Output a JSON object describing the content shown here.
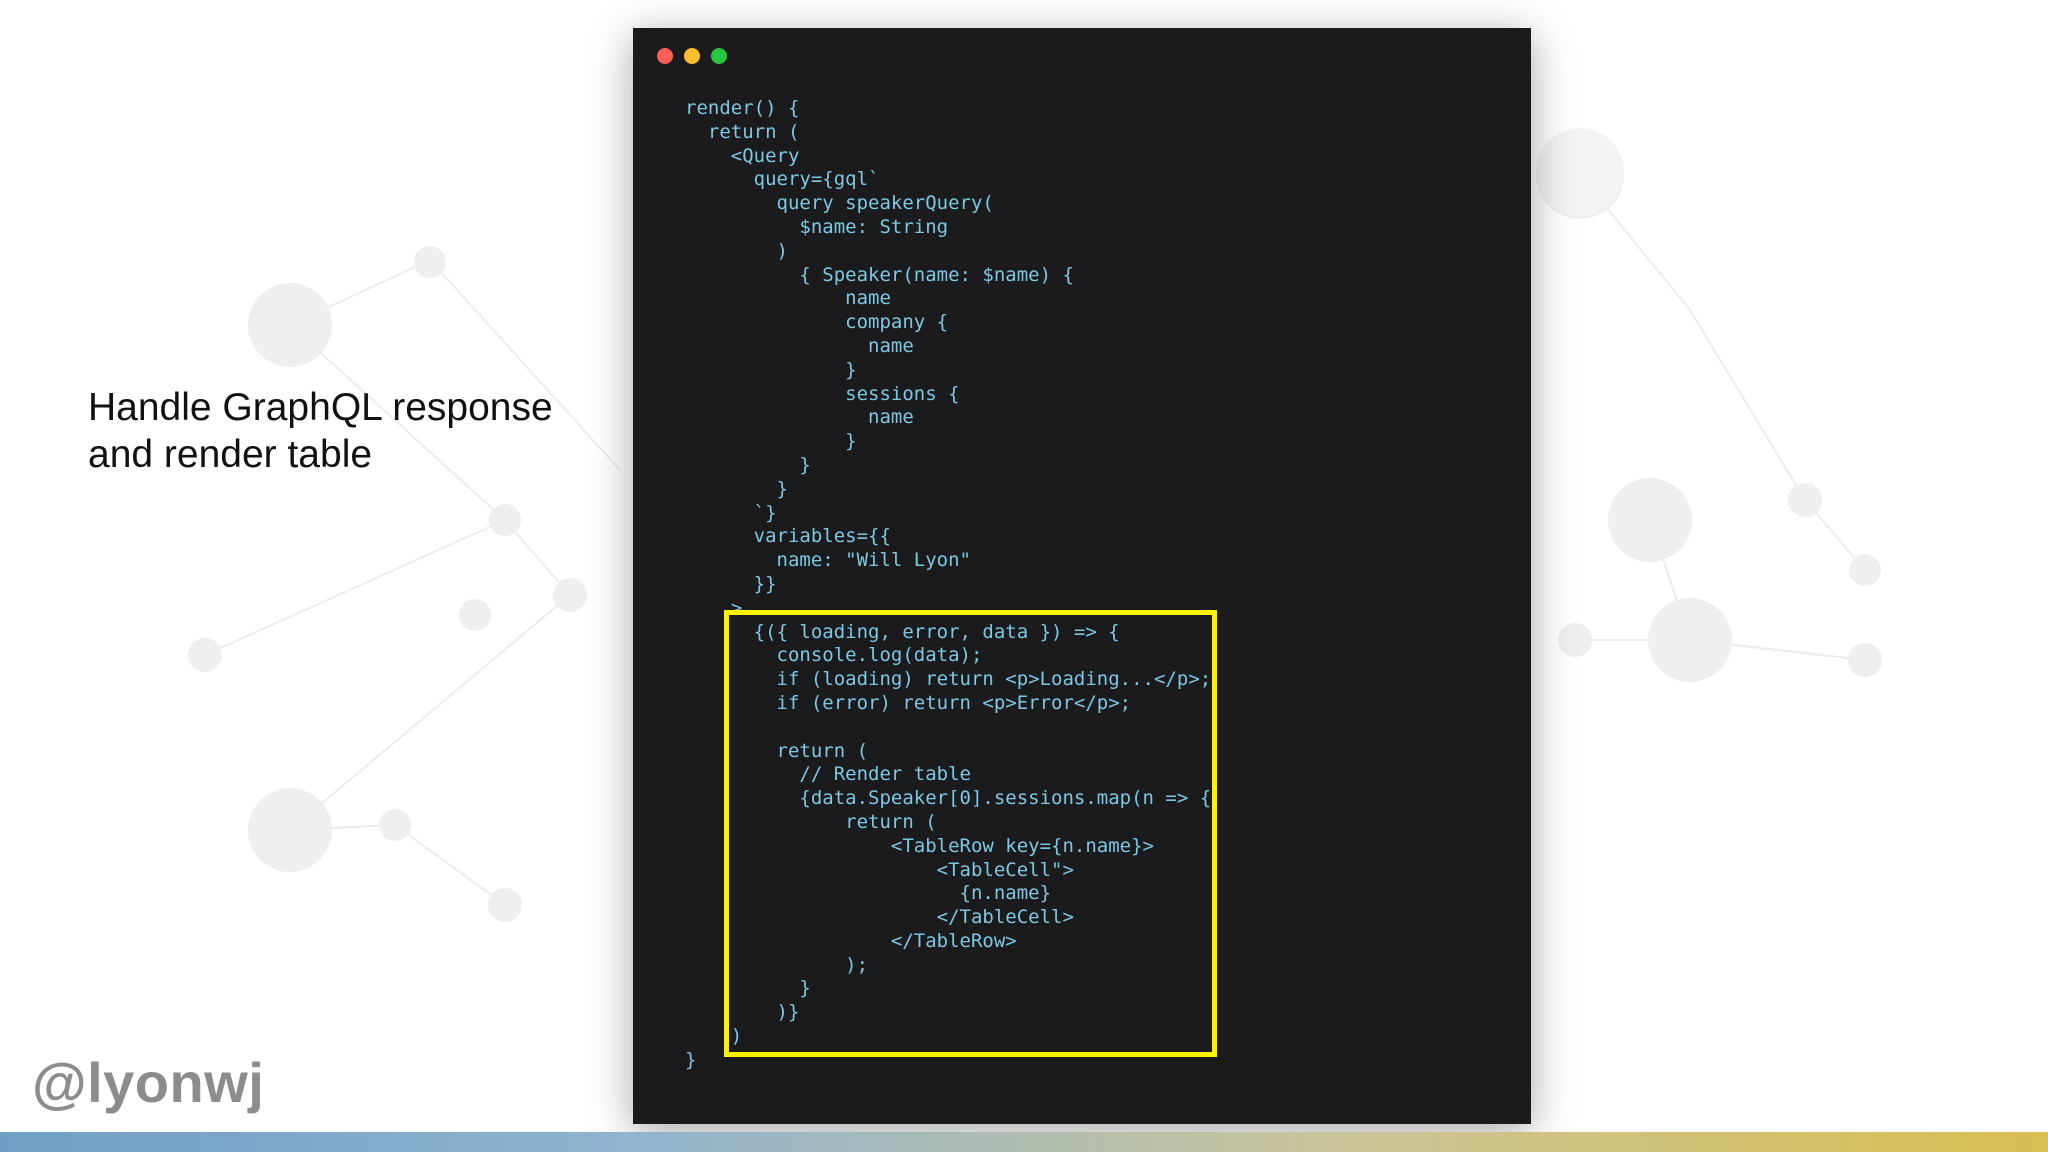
{
  "slide": {
    "headline_lines": [
      "Handle GraphQL response",
      "and render table"
    ],
    "handle": "@lyonwj"
  },
  "code_window": {
    "dots": [
      {
        "name": "close",
        "color": "#ff5f57"
      },
      {
        "name": "minimize",
        "color": "#febc2e"
      },
      {
        "name": "maximize",
        "color": "#28c840"
      }
    ],
    "lines": [
      "render() {",
      "  return (",
      "    <Query",
      "      query={gql`",
      "        query speakerQuery(",
      "          $name: String",
      "        )",
      "          { Speaker(name: $name) {",
      "              name",
      "              company {",
      "                name",
      "              }",
      "              sessions {",
      "                name",
      "              }",
      "          }",
      "        }",
      "      `}",
      "      variables={{",
      "        name: \"Will Lyon\"",
      "      }}",
      "    >",
      "      {({ loading, error, data }) => {",
      "        console.log(data);",
      "        if (loading) return <p>Loading...</p>;",
      "        if (error) return <p>Error</p>;",
      "",
      "        return (",
      "          // Render table",
      "          {data.Speaker[0].sessions.map(n => {",
      "              return (",
      "                  <TableRow key={n.name}>",
      "                      <TableCell\">",
      "                        {n.name}",
      "                      </TableCell>",
      "                  </TableRow>",
      "              );",
      "          }",
      "        )}",
      "    )",
      "}"
    ],
    "highlight_color": "#fff200"
  }
}
